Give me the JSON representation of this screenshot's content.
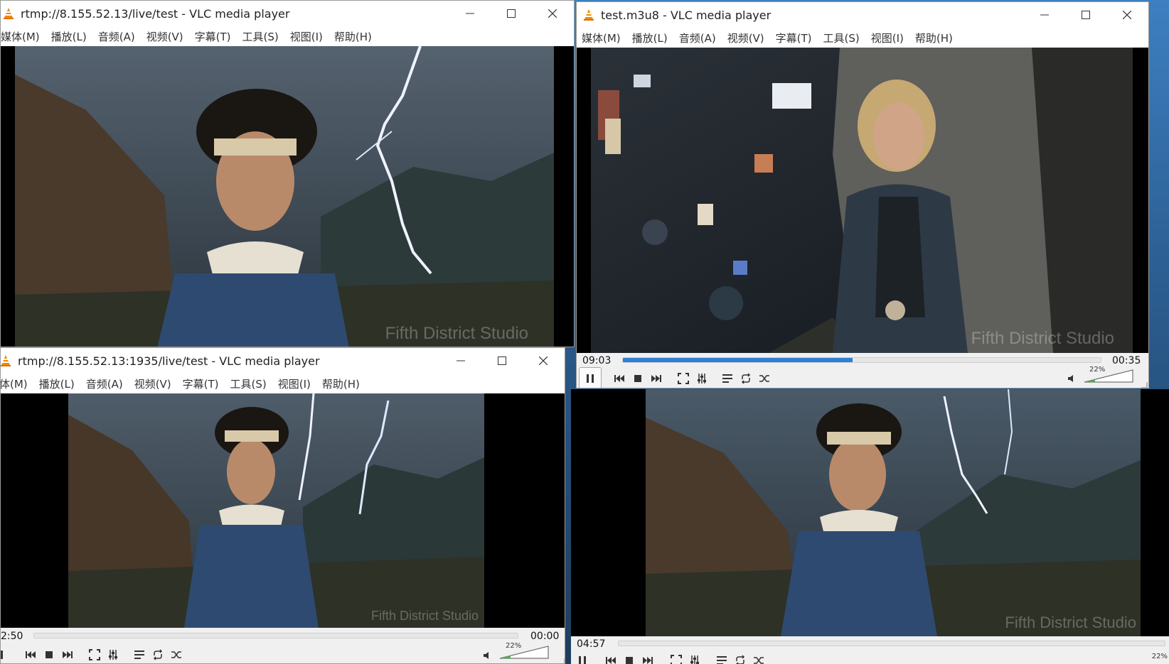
{
  "menus": [
    "媒体(M)",
    "播放(L)",
    "音频(A)",
    "视频(V)",
    "字幕(T)",
    "工具(S)",
    "视图(I)",
    "帮助(H)"
  ],
  "menus_cut": [
    "体(M)",
    "播放(L)",
    "音频(A)",
    "视频(V)",
    "字幕(T)",
    "工具(S)",
    "视图(I)",
    "帮助(H)"
  ],
  "watermark": "Fifth District Studio",
  "windows": {
    "w1": {
      "title": "rtmp://8.155.52.13/live/test - VLC media player"
    },
    "w2": {
      "title": "test.m3u8 - VLC media player",
      "elapsed": "09:03",
      "remaining": "00:35",
      "progress": 0.48,
      "volume": "22%"
    },
    "w3": {
      "title": "rtmp://8.155.52.13:1935/live/test - VLC media player",
      "elapsed": "2:50",
      "remaining": "00:00",
      "progress": 0.0,
      "volume": "22%"
    },
    "w4": {
      "elapsed": "04:57",
      "volume": "22%"
    }
  },
  "colors": {
    "accent": "#2f7fd6",
    "vlc_orange": "#f08a00",
    "title_bg": "#ffffff",
    "ctl_bg": "#f0f0f0"
  }
}
